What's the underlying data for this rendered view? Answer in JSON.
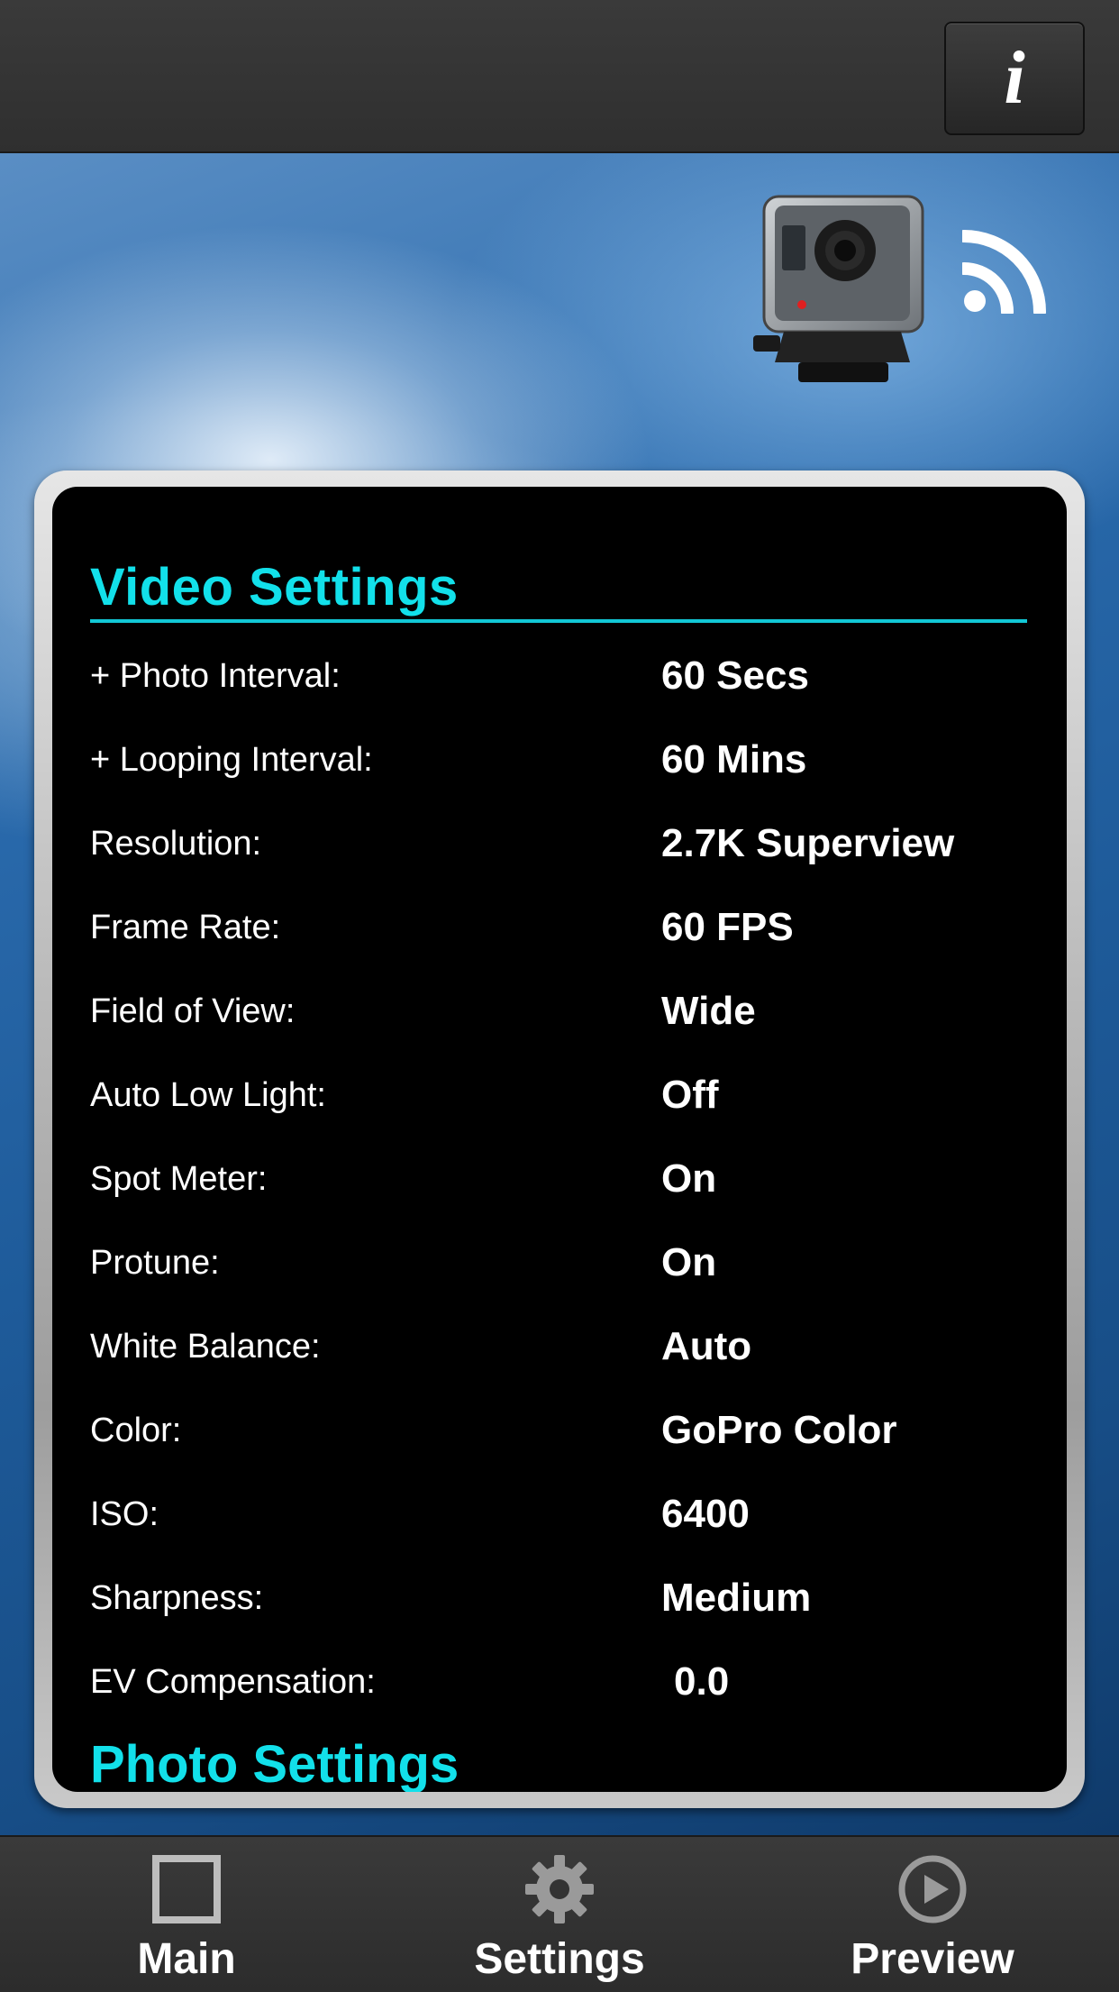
{
  "header": {
    "info_label": "i"
  },
  "video_settings": {
    "title": "Video Settings",
    "rows": [
      {
        "label": "+ Photo Interval:",
        "value": "60 Secs"
      },
      {
        "label": "+ Looping Interval:",
        "value": "60 Mins"
      },
      {
        "label": "Resolution:",
        "value": "2.7K Superview"
      },
      {
        "label": "Frame Rate:",
        "value": "60 FPS"
      },
      {
        "label": "Field of View:",
        "value": "Wide"
      },
      {
        "label": "Auto Low Light:",
        "value": "Off"
      },
      {
        "label": "Spot Meter:",
        "value": "On"
      },
      {
        "label": "Protune:",
        "value": "On"
      },
      {
        "label": "White Balance:",
        "value": "Auto"
      },
      {
        "label": "Color:",
        "value": "GoPro Color"
      },
      {
        "label": "ISO:",
        "value": "6400"
      },
      {
        "label": "Sharpness:",
        "value": "Medium"
      },
      {
        "label": "EV Compensation:",
        "value": "0.0"
      }
    ]
  },
  "photo_settings": {
    "title": "Photo Settings"
  },
  "tabs": [
    {
      "label": "Main",
      "icon": "square-icon"
    },
    {
      "label": "Settings",
      "icon": "gear-icon"
    },
    {
      "label": "Preview",
      "icon": "play-circle-icon"
    }
  ],
  "colors": {
    "accent": "#12e0ea",
    "panel_bg": "#000000",
    "bar_bg": "#333333"
  }
}
